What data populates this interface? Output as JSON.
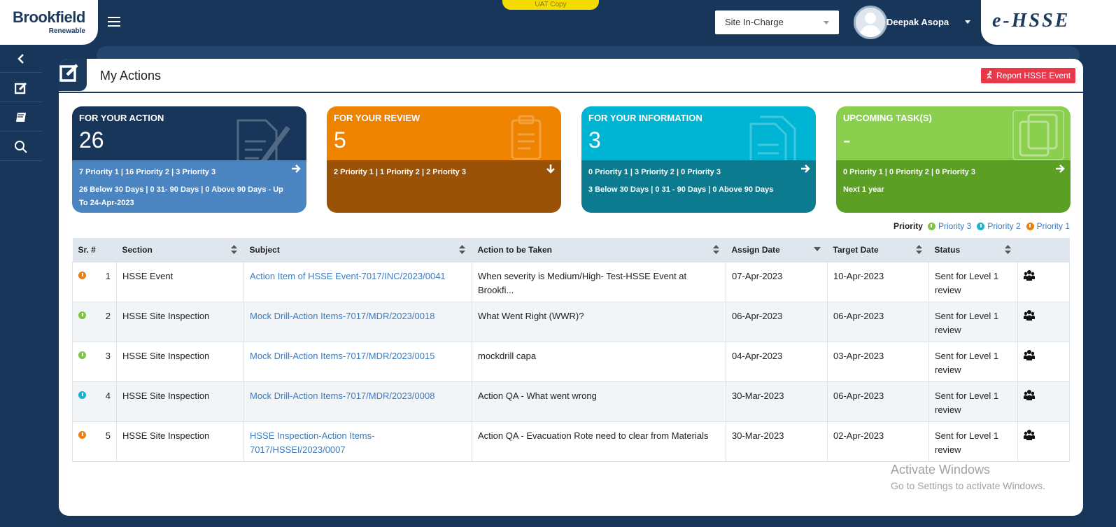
{
  "header": {
    "brand": "Brookfield",
    "brand_sub": "Renewable",
    "uat_label": "UAT Copy",
    "role_select": "Site In-Charge",
    "user_name": "Deepak Asopa",
    "app_logo": "e-HSSE"
  },
  "page": {
    "title": "My Actions",
    "report_button": "Report HSSE Event"
  },
  "cards": [
    {
      "title": "FOR YOUR ACTION",
      "count": "26",
      "line1": "7 Priority 1 | 16 Priority 2 | 3 Priority 3",
      "line2": "26 Below 30 Days | 0 31- 90 Days | 0 Above 90 Days - Up To 24-Apr-2023",
      "arrow": "right-arrow-icon",
      "color": "#17365a"
    },
    {
      "title": "FOR YOUR REVIEW",
      "count": "5",
      "line1": "2 Priority 1 | 1 Priority 2 | 2 Priority 3",
      "line2": "",
      "arrow": "down-arrow-icon",
      "color": "#ee8300"
    },
    {
      "title": "FOR YOUR INFORMATION",
      "count": "3",
      "line1": "0 Priority 1 | 3 Priority 2 | 0 Priority 3",
      "line2": "3 Below 30 Days | 0 31 - 90 Days | 0 Above 90 Days",
      "arrow": "right-arrow-icon",
      "color": "#00b5d4"
    },
    {
      "title": "UPCOMING TASK(S)",
      "count": "-",
      "line1": "0 Priority 1 | 0 Priority 2 | 0 Priority 3",
      "line2": "Next 1 year",
      "arrow": "right-arrow-icon",
      "color": "#8bcf4f"
    }
  ],
  "legend": {
    "label": "Priority",
    "items": [
      {
        "text": "Priority 3",
        "color": "#7ec545"
      },
      {
        "text": "Priority 2",
        "color": "#1ab3cf"
      },
      {
        "text": "Priority 1",
        "color": "#ef7d0f"
      }
    ]
  },
  "table": {
    "columns": [
      "Sr. #",
      "Section",
      "Subject",
      "Action to be Taken",
      "Assign Date",
      "Target Date",
      "Status"
    ],
    "rows": [
      {
        "priority": "Priority 1",
        "sr": "1",
        "section": "HSSE Event",
        "subject": "Action Item of HSSE Event-7017/INC/2023/0041",
        "action": "When severity is Medium/High- Test-HSSE Event at Brookfi...",
        "assign": "07-Apr-2023",
        "target": "10-Apr-2023",
        "status": "Sent for Level 1 review"
      },
      {
        "priority": "Priority 3",
        "sr": "2",
        "section": "HSSE Site Inspection",
        "subject": "Mock Drill-Action Items-7017/MDR/2023/0018",
        "action": "What Went Right (WWR)?",
        "assign": "06-Apr-2023",
        "target": "06-Apr-2023",
        "status": "Sent for Level 1 review"
      },
      {
        "priority": "Priority 3",
        "sr": "3",
        "section": "HSSE Site Inspection",
        "subject": "Mock Drill-Action Items-7017/MDR/2023/0015",
        "action": "mockdrill capa",
        "assign": "04-Apr-2023",
        "target": "03-Apr-2023",
        "status": "Sent for Level 1 review"
      },
      {
        "priority": "Priority 2",
        "sr": "4",
        "section": "HSSE Site Inspection",
        "subject": "Mock Drill-Action Items-7017/MDR/2023/0008",
        "action": "Action QA - What went wrong",
        "assign": "30-Mar-2023",
        "target": "06-Apr-2023",
        "status": "Sent for Level 1 review"
      },
      {
        "priority": "Priority 1",
        "sr": "5",
        "section": "HSSE Site Inspection",
        "subject": "HSSE Inspection-Action Items-7017/HSSEI/2023/0007",
        "action": "Action QA - Evacuation Rote need to clear from Materials",
        "assign": "30-Mar-2023",
        "target": "02-Apr-2023",
        "status": "Sent for Level 1 review"
      }
    ]
  },
  "watermark": {
    "line1": "Activate Windows",
    "line2": "Go to Settings to activate Windows."
  }
}
